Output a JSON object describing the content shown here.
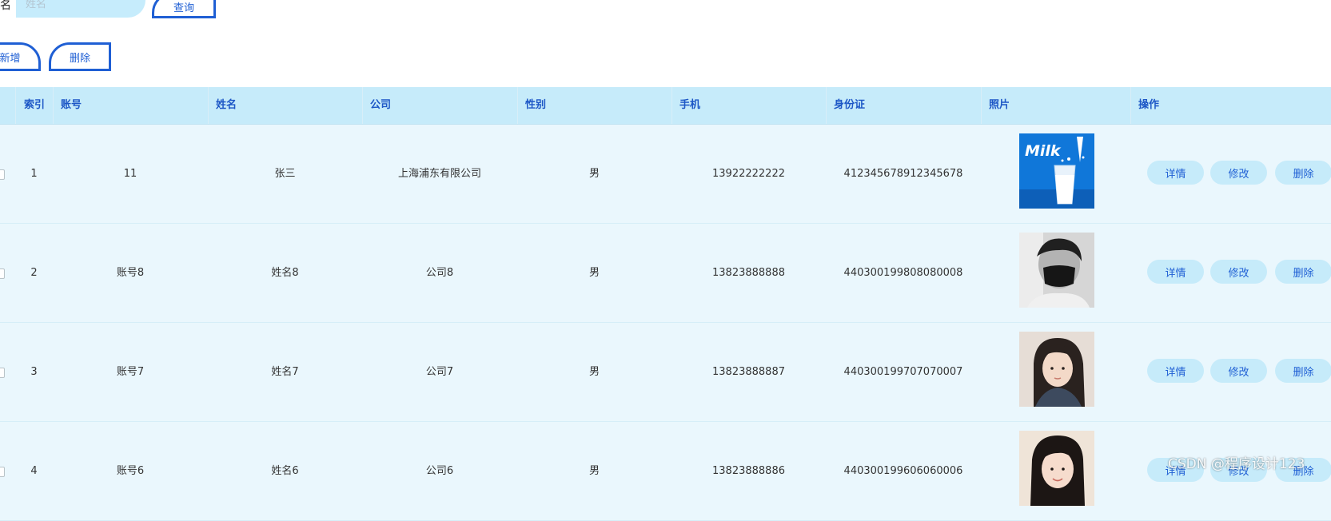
{
  "search": {
    "label": "名",
    "placeholder": "姓名",
    "query_label": "查询"
  },
  "toolbar": {
    "add_label": "新增",
    "delete_label": "删除"
  },
  "table": {
    "headers": {
      "index": "索引",
      "account": "账号",
      "name": "姓名",
      "company": "公司",
      "gender": "性别",
      "phone": "手机",
      "id_card": "身份证",
      "photo": "照片",
      "actions": "操作"
    },
    "rows": [
      {
        "index": "1",
        "account": "11",
        "name": "张三",
        "company": "上海浦东有限公司",
        "gender": "男",
        "phone": "13922222222",
        "id_card": "412345678912345678",
        "photo": "milk-poster"
      },
      {
        "index": "2",
        "account": "账号8",
        "name": "姓名8",
        "company": "公司8",
        "gender": "男",
        "phone": "13823888888",
        "id_card": "440300199808080008",
        "photo": "masked-person"
      },
      {
        "index": "3",
        "account": "账号7",
        "name": "姓名7",
        "company": "公司7",
        "gender": "男",
        "phone": "13823888887",
        "id_card": "440300199707070007",
        "photo": "girl-portrait"
      },
      {
        "index": "4",
        "account": "账号6",
        "name": "姓名6",
        "company": "公司6",
        "gender": "男",
        "phone": "13823888886",
        "id_card": "440300199606060006",
        "photo": "girl-portrait-2"
      }
    ],
    "row_actions": {
      "detail": "详情",
      "edit": "修改",
      "delete": "删除"
    }
  },
  "photo_text": {
    "milk": "Milk"
  },
  "watermark": "CSDN @程序设计123",
  "colors": {
    "accent": "#1f5fd4",
    "header_bg": "#c6ebfa",
    "row_bg": "#eaf7fd"
  }
}
